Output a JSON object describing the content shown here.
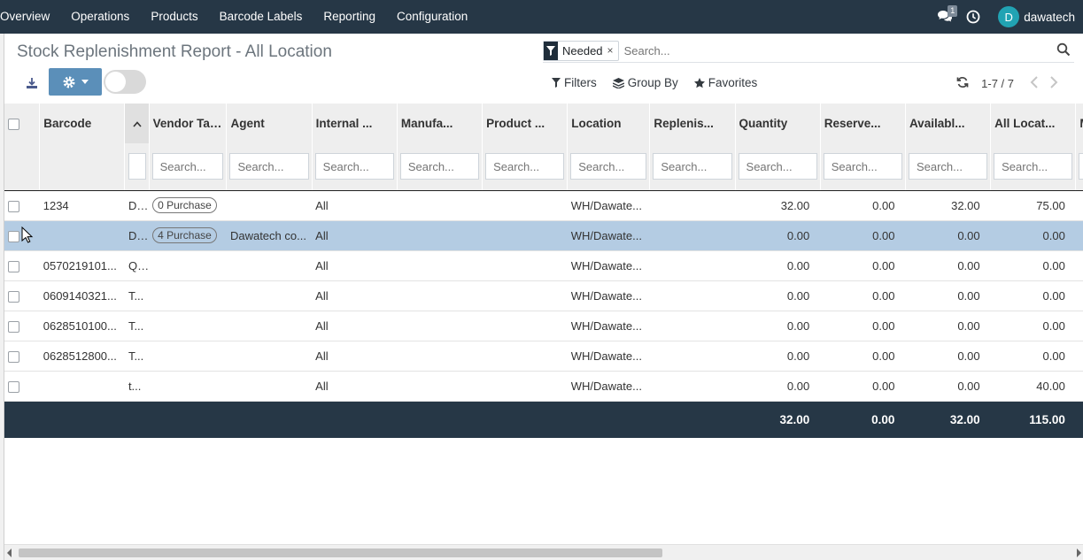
{
  "navbar": {
    "menu": [
      "Overview",
      "Operations",
      "Products",
      "Barcode Labels",
      "Reporting",
      "Configuration"
    ],
    "messages_count": "1",
    "user_initial": "D",
    "username": "dawatech"
  },
  "page": {
    "title": "Stock Replenishment Report - All Location"
  },
  "search": {
    "facet": "Needed",
    "facet_close": "×",
    "placeholder": "Search..."
  },
  "filters": {
    "filters_label": "Filters",
    "groupby_label": "Group By",
    "favorites_label": "Favorites"
  },
  "pager": {
    "value": "1-7 / 7"
  },
  "table": {
    "columns": [
      "Barcode",
      "Vendor Tax...",
      "Agent",
      "Internal ...",
      "Manufa...",
      "Product ...",
      "Location",
      "Replenis...",
      "Quantity",
      "Reserve...",
      "Availabl...",
      "All Locat...",
      "MAIN..."
    ],
    "search_placeholder": "Search...",
    "rows": [
      {
        "barcode": "1234",
        "sort": "D...",
        "vendor": "0 Purchase",
        "agent": "",
        "internal": "All",
        "manufa": "",
        "product": "",
        "location": "WH/Dawate...",
        "replenish": "",
        "quantity": "32.00",
        "reserved": "0.00",
        "available": "32.00",
        "all_loc": "75.00",
        "main": ""
      },
      {
        "barcode": "",
        "sort": "D...",
        "vendor": "4 Purchase",
        "agent": "Dawatech co...",
        "internal": "All",
        "manufa": "",
        "product": "",
        "location": "WH/Dawate...",
        "replenish": "",
        "quantity": "0.00",
        "reserved": "0.00",
        "available": "0.00",
        "all_loc": "0.00",
        "main": ""
      },
      {
        "barcode": "0570219101...",
        "sort": "Q...",
        "vendor": "",
        "agent": "",
        "internal": "All",
        "manufa": "",
        "product": "",
        "location": "WH/Dawate...",
        "replenish": "",
        "quantity": "0.00",
        "reserved": "0.00",
        "available": "0.00",
        "all_loc": "0.00",
        "main": ""
      },
      {
        "barcode": "0609140321...",
        "sort": "T...",
        "vendor": "",
        "agent": "",
        "internal": "All",
        "manufa": "",
        "product": "",
        "location": "WH/Dawate...",
        "replenish": "",
        "quantity": "0.00",
        "reserved": "0.00",
        "available": "0.00",
        "all_loc": "0.00",
        "main": ""
      },
      {
        "barcode": "0628510100...",
        "sort": "T...",
        "vendor": "",
        "agent": "",
        "internal": "All",
        "manufa": "",
        "product": "",
        "location": "WH/Dawate...",
        "replenish": "",
        "quantity": "0.00",
        "reserved": "0.00",
        "available": "0.00",
        "all_loc": "0.00",
        "main": ""
      },
      {
        "barcode": "0628512800...",
        "sort": "T...",
        "vendor": "",
        "agent": "",
        "internal": "All",
        "manufa": "",
        "product": "",
        "location": "WH/Dawate...",
        "replenish": "",
        "quantity": "0.00",
        "reserved": "0.00",
        "available": "0.00",
        "all_loc": "0.00",
        "main": ""
      },
      {
        "barcode": "",
        "sort": "t...",
        "vendor": "",
        "agent": "",
        "internal": "All",
        "manufa": "",
        "product": "",
        "location": "WH/Dawate...",
        "replenish": "",
        "quantity": "0.00",
        "reserved": "0.00",
        "available": "0.00",
        "all_loc": "40.00",
        "main": ""
      }
    ],
    "totals": {
      "quantity": "32.00",
      "reserved": "0.00",
      "available": "32.00",
      "all_loc": "115.00"
    }
  },
  "colors": {
    "navbar_bg": "#263746",
    "selected_row": "#b4cce3",
    "gear_button": "#5b8fb9"
  }
}
